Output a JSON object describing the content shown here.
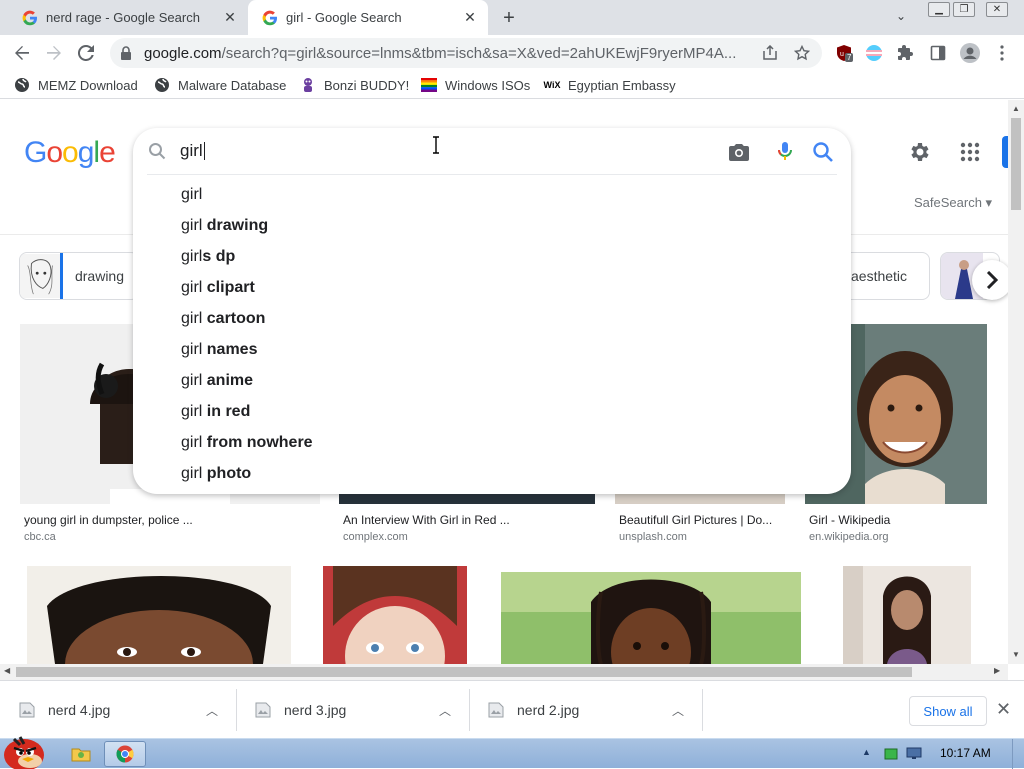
{
  "browser": {
    "tabs": [
      {
        "title": "nerd rage - Google Search",
        "active": false
      },
      {
        "title": "girl - Google Search",
        "active": true
      }
    ],
    "url_host": "google.com",
    "url_rest": "/search?q=girl&source=lnms&tbm=isch&sa=X&ved=2ahUKEwjF9ryerMP4A...",
    "extension_badge": "7"
  },
  "bookmarks": [
    {
      "label": "MEMZ Download",
      "icon": "globe-icon"
    },
    {
      "label": "Malware Database",
      "icon": "globe-icon"
    },
    {
      "label": "Bonzi BUDDY!",
      "icon": "bonzi-icon"
    },
    {
      "label": "Windows ISOs",
      "icon": "windows-flag-icon"
    },
    {
      "label": "Egyptian Embassy",
      "icon": "wix-icon"
    }
  ],
  "search": {
    "query": "girl",
    "suggestions": [
      {
        "prefix": "girl",
        "bold": ""
      },
      {
        "prefix": "girl ",
        "bold": "drawing"
      },
      {
        "prefix": "girl",
        "bold": "s dp"
      },
      {
        "prefix": "girl ",
        "bold": "clipart"
      },
      {
        "prefix": "girl ",
        "bold": "cartoon"
      },
      {
        "prefix": "girl ",
        "bold": "names"
      },
      {
        "prefix": "girl ",
        "bold": "anime"
      },
      {
        "prefix": "girl ",
        "bold": "in red"
      },
      {
        "prefix": "girl ",
        "bold": "from nowhere"
      },
      {
        "prefix": "girl ",
        "bold": "photo"
      }
    ]
  },
  "safesearch_label": "SafeSearch",
  "chips": [
    {
      "label": "drawing"
    },
    {
      "label": "aesthetic"
    }
  ],
  "images": [
    {
      "caption": "young girl in dumpster, police ...",
      "source": "cbc.ca"
    },
    {
      "caption": "An Interview With Girl in Red ...",
      "source": "complex.com"
    },
    {
      "caption": "Beautifull Girl Pictures | Do...",
      "source": "unsplash.com"
    },
    {
      "caption": "Girl - Wikipedia",
      "source": "en.wikipedia.org"
    }
  ],
  "downloads": [
    {
      "name": "nerd 4.jpg"
    },
    {
      "name": "nerd 3.jpg"
    },
    {
      "name": "nerd 2.jpg"
    }
  ],
  "downloads_show_all": "Show all",
  "taskbar": {
    "clock": "10:17 AM"
  },
  "colors": {
    "google_blue": "#4285f4",
    "google_red": "#ea4335",
    "google_yellow": "#fbbc05",
    "google_green": "#34a853",
    "link_blue": "#1a73e8"
  }
}
